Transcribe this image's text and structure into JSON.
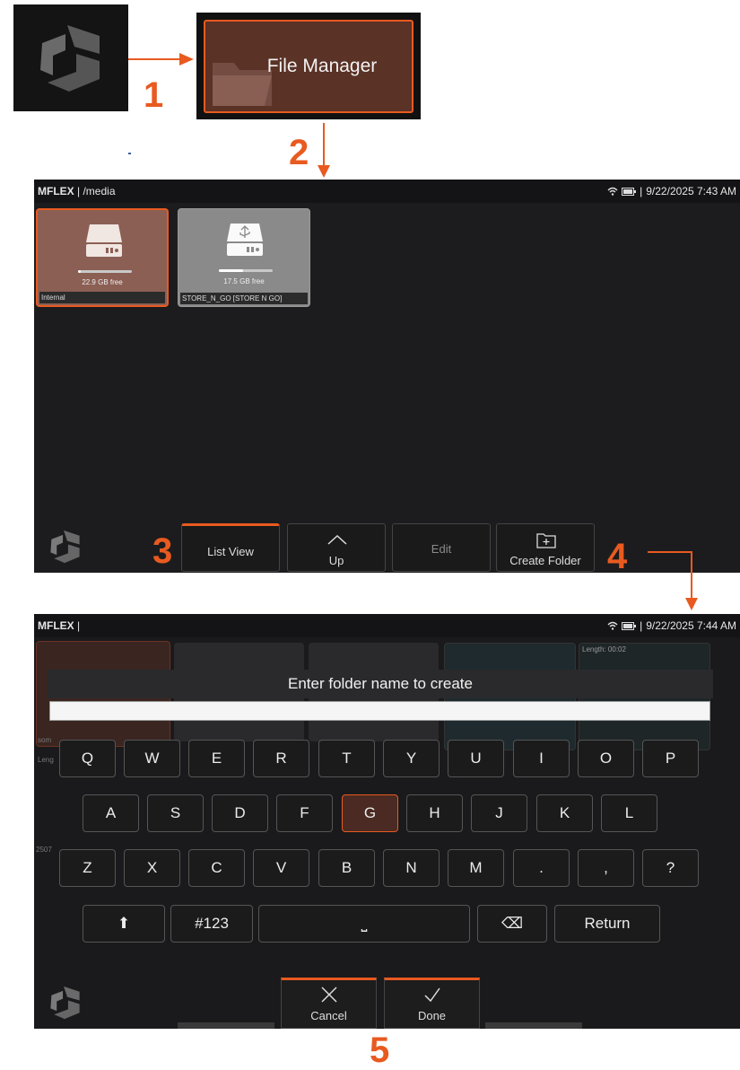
{
  "colors": {
    "accent": "#e85a20",
    "tile_selected": "#8c5f54",
    "tile_usb": "#8a8a8a",
    "screen_bg": "#1c1c1e"
  },
  "steps": {
    "s1": "1",
    "s2": "2",
    "s3": "3",
    "s4": "4",
    "s5": "5"
  },
  "file_manager": {
    "label": "File Manager",
    "icon": "folder-icon"
  },
  "screen1": {
    "status": {
      "app": "MFLEX",
      "path": "/media",
      "datetime": "9/22/2025  7:43 AM",
      "wifi_icon": "wifi-icon",
      "battery_icon": "battery-icon"
    },
    "drives": [
      {
        "label": "Internal",
        "free": "22.9 GB free",
        "usage": 0.05,
        "icon": "hard-drive-icon"
      },
      {
        "label": "STORE_N_GO [STORE N GO]",
        "free": "17.5 GB free",
        "usage": 0.45,
        "icon": "usb-drive-icon"
      }
    ],
    "toolbar": {
      "list_view": "List View",
      "up": "Up",
      "edit": "Edit",
      "create_folder": "Create Folder"
    }
  },
  "screen2": {
    "status": {
      "app": "MFLEX",
      "datetime": "9/22/2025  7:44 AM"
    },
    "background": {
      "length_label": "Length: 00:02",
      "partial_1": "som",
      "partial_2": "Leng",
      "partial_3": "2507"
    },
    "dialog": {
      "title": "Enter folder name to create",
      "value": ""
    },
    "keyboard": {
      "row1": [
        "Q",
        "W",
        "E",
        "R",
        "T",
        "Y",
        "U",
        "I",
        "O",
        "P"
      ],
      "row2": [
        "A",
        "S",
        "D",
        "F",
        "G",
        "H",
        "J",
        "K",
        "L"
      ],
      "row3": [
        "Z",
        "X",
        "C",
        "V",
        "B",
        "N",
        "M",
        ".",
        ",",
        "?"
      ],
      "row4": {
        "shift": "⬆",
        "symbols": "#123",
        "space": "⎵",
        "backspace": "⌫",
        "return": "Return"
      },
      "highlighted": "G"
    },
    "buttons": {
      "cancel": "Cancel",
      "done": "Done"
    }
  }
}
